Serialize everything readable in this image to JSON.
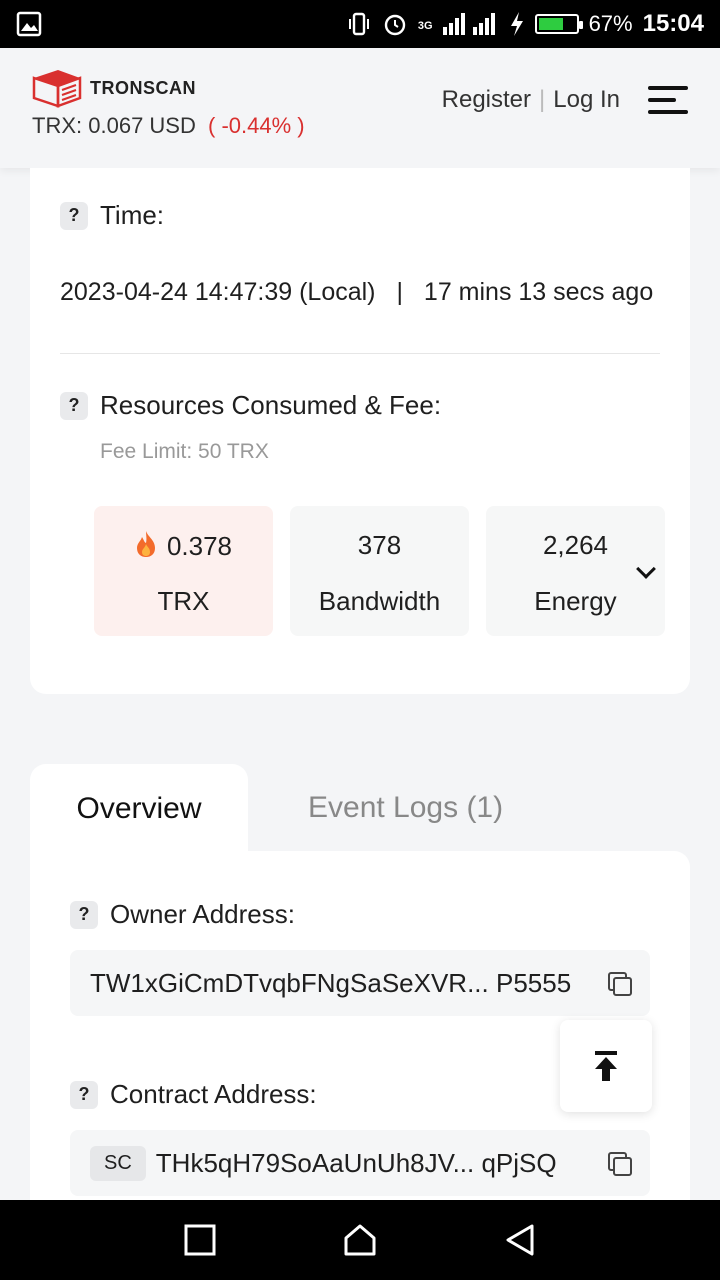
{
  "status_bar": {
    "network": "3G",
    "battery_percent": "67%",
    "time": "15:04",
    "battery_level": 0.67,
    "battery_color": "#2ecc40"
  },
  "header": {
    "logo_text": "TRONSCAN",
    "price_prefix": "TRX:",
    "price_value": "0.067 USD",
    "price_change": "( -0.44% )",
    "register_label": "Register",
    "separator": "|",
    "login_label": "Log In",
    "change_color": "#d9302f"
  },
  "details": {
    "time_label": "Time:",
    "time_value": "2023-04-24 14:47:39 (Local)",
    "time_sep": "|",
    "time_ago": "17 mins 13 secs ago",
    "resources_label": "Resources Consumed & Fee:",
    "fee_limit": "Fee Limit: 50 TRX",
    "resources": [
      {
        "value": "0.378",
        "unit": "TRX",
        "icon": "fire-icon"
      },
      {
        "value": "378",
        "unit": "Bandwidth"
      },
      {
        "value": "2,264",
        "unit": "Energy"
      }
    ]
  },
  "tabs": {
    "overview": "Overview",
    "event_logs": "Event Logs (1)"
  },
  "overview": {
    "owner_label": "Owner Address:",
    "owner_address": "TW1xGiCmDTvqbFNgSaSeXVR... P5555",
    "contract_label": "Contract Address:",
    "contract_badge": "SC",
    "contract_address": "THk5qH79SoAaUnUh8JV... qPjSQ"
  },
  "help_glyph": "?"
}
